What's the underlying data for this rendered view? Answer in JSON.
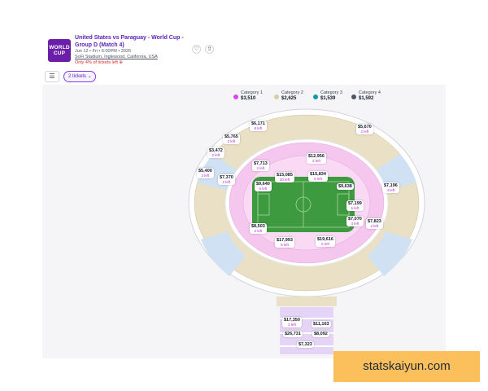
{
  "event": {
    "title": "United States vs Paraguay - World Cup - Group D (Match 4)",
    "date_line": "Jun 12 • Fri • 6:00PM • 2026",
    "venue": "SoFi Stadium, Inglewood, California, USA",
    "alert": "Only 4% of tickets left ⊕",
    "logo_line1": "WORLD",
    "logo_line2": "CUP"
  },
  "actions": {
    "favorite_icon": "♡",
    "share_icon": "⇧"
  },
  "filters": {
    "filter_icon": "☰",
    "quantity_label": "2 tickets ⌄"
  },
  "legend": [
    {
      "name": "Category 1",
      "price": "$3,510",
      "color": "#d946ef"
    },
    {
      "name": "Category 2",
      "price": "$2,625",
      "color": "#d6cfa6"
    },
    {
      "name": "Category 3",
      "price": "$1,539",
      "color": "#0f9aa6"
    },
    {
      "name": "Category 4",
      "price": "$1,592",
      "color": "#4b5563"
    }
  ],
  "colors": {
    "cat1": "#f5c6ee",
    "cat2": "#e9e0c6",
    "cat3": "#cfe1f2",
    "field": "#3e9a3e",
    "brand": "#6b1fa8"
  },
  "price_pins": [
    {
      "price": "$6,171",
      "left": "8 left"
    },
    {
      "price": "$5,765",
      "left": "2 left"
    },
    {
      "price": "$5,670",
      "left": "2 left"
    },
    {
      "price": "$3,472",
      "left": "2 left"
    },
    {
      "price": "$12,956",
      "left": "2 left"
    },
    {
      "price": "$7,713",
      "left": "2 left"
    },
    {
      "price": "$5,400",
      "left": "2 left"
    },
    {
      "price": "$7,370",
      "left": "2 left"
    },
    {
      "price": "$15,085",
      "left": "20 left"
    },
    {
      "price": "$15,834",
      "left": "6 left"
    },
    {
      "price": "$9,640",
      "left": "6 left"
    },
    {
      "price": "$9,638",
      "left": ""
    },
    {
      "price": "$7,196",
      "left": "4 left"
    },
    {
      "price": "$7,199",
      "left": "6 left"
    },
    {
      "price": "$7,070",
      "left": "4 left"
    },
    {
      "price": "$7,823",
      "left": "2 left"
    },
    {
      "price": "$8,503",
      "left": "2 left"
    },
    {
      "price": "$17,993",
      "left": "8 left"
    },
    {
      "price": "$19,616",
      "left": "6 left"
    },
    {
      "price": "$17,350",
      "left": "2 left"
    },
    {
      "price": "$11,163",
      "left": ""
    },
    {
      "price": "$26,731",
      "left": ""
    },
    {
      "price": "$8,092",
      "left": ""
    },
    {
      "price": "$7,323",
      "left": ""
    }
  ],
  "watermark": "statskaiyun.com"
}
